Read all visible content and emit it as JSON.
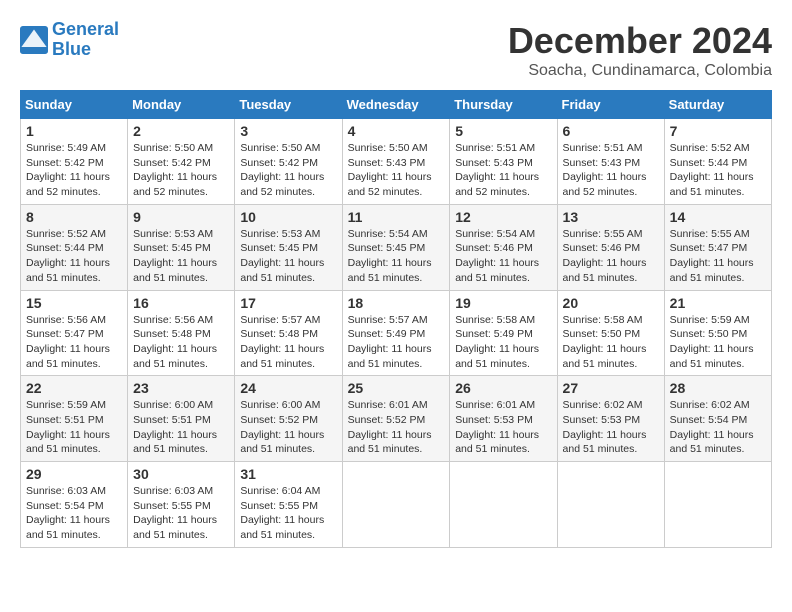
{
  "logo": {
    "line1": "General",
    "line2": "Blue"
  },
  "title": "December 2024",
  "subtitle": "Soacha, Cundinamarca, Colombia",
  "days_of_week": [
    "Sunday",
    "Monday",
    "Tuesday",
    "Wednesday",
    "Thursday",
    "Friday",
    "Saturday"
  ],
  "weeks": [
    [
      {
        "day": "1",
        "sunrise": "5:49 AM",
        "sunset": "5:42 PM",
        "daylight": "11 hours and 52 minutes."
      },
      {
        "day": "2",
        "sunrise": "5:50 AM",
        "sunset": "5:42 PM",
        "daylight": "11 hours and 52 minutes."
      },
      {
        "day": "3",
        "sunrise": "5:50 AM",
        "sunset": "5:42 PM",
        "daylight": "11 hours and 52 minutes."
      },
      {
        "day": "4",
        "sunrise": "5:50 AM",
        "sunset": "5:43 PM",
        "daylight": "11 hours and 52 minutes."
      },
      {
        "day": "5",
        "sunrise": "5:51 AM",
        "sunset": "5:43 PM",
        "daylight": "11 hours and 52 minutes."
      },
      {
        "day": "6",
        "sunrise": "5:51 AM",
        "sunset": "5:43 PM",
        "daylight": "11 hours and 52 minutes."
      },
      {
        "day": "7",
        "sunrise": "5:52 AM",
        "sunset": "5:44 PM",
        "daylight": "11 hours and 51 minutes."
      }
    ],
    [
      {
        "day": "8",
        "sunrise": "5:52 AM",
        "sunset": "5:44 PM",
        "daylight": "11 hours and 51 minutes."
      },
      {
        "day": "9",
        "sunrise": "5:53 AM",
        "sunset": "5:45 PM",
        "daylight": "11 hours and 51 minutes."
      },
      {
        "day": "10",
        "sunrise": "5:53 AM",
        "sunset": "5:45 PM",
        "daylight": "11 hours and 51 minutes."
      },
      {
        "day": "11",
        "sunrise": "5:54 AM",
        "sunset": "5:45 PM",
        "daylight": "11 hours and 51 minutes."
      },
      {
        "day": "12",
        "sunrise": "5:54 AM",
        "sunset": "5:46 PM",
        "daylight": "11 hours and 51 minutes."
      },
      {
        "day": "13",
        "sunrise": "5:55 AM",
        "sunset": "5:46 PM",
        "daylight": "11 hours and 51 minutes."
      },
      {
        "day": "14",
        "sunrise": "5:55 AM",
        "sunset": "5:47 PM",
        "daylight": "11 hours and 51 minutes."
      }
    ],
    [
      {
        "day": "15",
        "sunrise": "5:56 AM",
        "sunset": "5:47 PM",
        "daylight": "11 hours and 51 minutes."
      },
      {
        "day": "16",
        "sunrise": "5:56 AM",
        "sunset": "5:48 PM",
        "daylight": "11 hours and 51 minutes."
      },
      {
        "day": "17",
        "sunrise": "5:57 AM",
        "sunset": "5:48 PM",
        "daylight": "11 hours and 51 minutes."
      },
      {
        "day": "18",
        "sunrise": "5:57 AM",
        "sunset": "5:49 PM",
        "daylight": "11 hours and 51 minutes."
      },
      {
        "day": "19",
        "sunrise": "5:58 AM",
        "sunset": "5:49 PM",
        "daylight": "11 hours and 51 minutes."
      },
      {
        "day": "20",
        "sunrise": "5:58 AM",
        "sunset": "5:50 PM",
        "daylight": "11 hours and 51 minutes."
      },
      {
        "day": "21",
        "sunrise": "5:59 AM",
        "sunset": "5:50 PM",
        "daylight": "11 hours and 51 minutes."
      }
    ],
    [
      {
        "day": "22",
        "sunrise": "5:59 AM",
        "sunset": "5:51 PM",
        "daylight": "11 hours and 51 minutes."
      },
      {
        "day": "23",
        "sunrise": "6:00 AM",
        "sunset": "5:51 PM",
        "daylight": "11 hours and 51 minutes."
      },
      {
        "day": "24",
        "sunrise": "6:00 AM",
        "sunset": "5:52 PM",
        "daylight": "11 hours and 51 minutes."
      },
      {
        "day": "25",
        "sunrise": "6:01 AM",
        "sunset": "5:52 PM",
        "daylight": "11 hours and 51 minutes."
      },
      {
        "day": "26",
        "sunrise": "6:01 AM",
        "sunset": "5:53 PM",
        "daylight": "11 hours and 51 minutes."
      },
      {
        "day": "27",
        "sunrise": "6:02 AM",
        "sunset": "5:53 PM",
        "daylight": "11 hours and 51 minutes."
      },
      {
        "day": "28",
        "sunrise": "6:02 AM",
        "sunset": "5:54 PM",
        "daylight": "11 hours and 51 minutes."
      }
    ],
    [
      {
        "day": "29",
        "sunrise": "6:03 AM",
        "sunset": "5:54 PM",
        "daylight": "11 hours and 51 minutes."
      },
      {
        "day": "30",
        "sunrise": "6:03 AM",
        "sunset": "5:55 PM",
        "daylight": "11 hours and 51 minutes."
      },
      {
        "day": "31",
        "sunrise": "6:04 AM",
        "sunset": "5:55 PM",
        "daylight": "11 hours and 51 minutes."
      },
      null,
      null,
      null,
      null
    ]
  ],
  "labels": {
    "sunrise": "Sunrise:",
    "sunset": "Sunset:",
    "daylight": "Daylight:"
  }
}
